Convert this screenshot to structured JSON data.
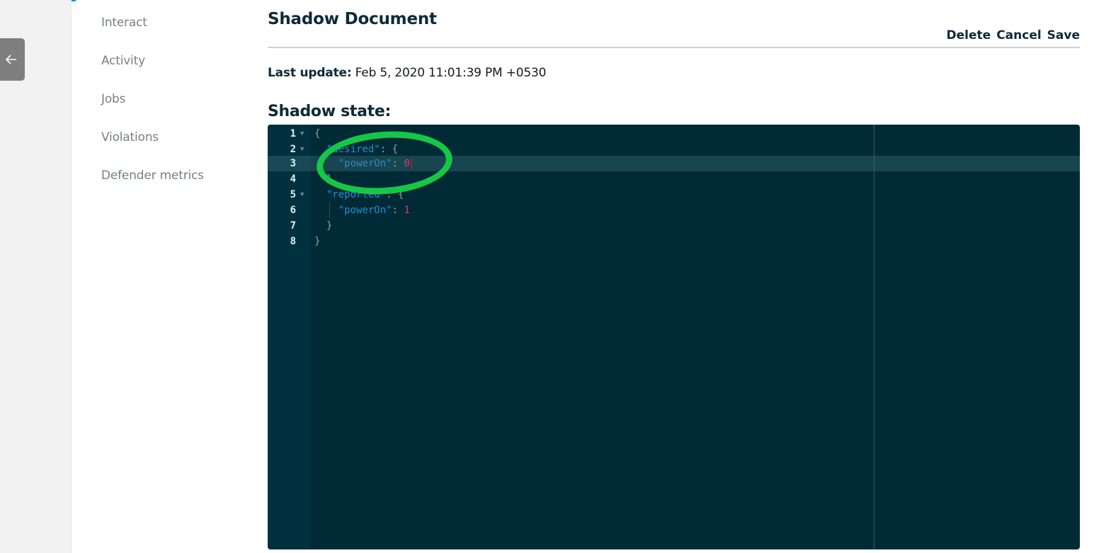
{
  "left_rail": {
    "back_button": {
      "icon": "arrow-left-icon"
    }
  },
  "subnav": {
    "items": [
      {
        "label": "Interact"
      },
      {
        "label": "Activity"
      },
      {
        "label": "Jobs"
      },
      {
        "label": "Violations"
      },
      {
        "label": "Defender metrics"
      }
    ]
  },
  "header": {
    "title": "Shadow Document",
    "actions": {
      "delete": "Delete",
      "cancel": "Cancel",
      "save": "Save"
    }
  },
  "last_update": {
    "label": "Last update:",
    "value": "Feb 5, 2020 11:01:39 PM +0530"
  },
  "shadow_state": {
    "label": "Shadow state:",
    "active_line": 3,
    "lines": [
      {
        "num": "1",
        "text": "{"
      },
      {
        "num": "2",
        "indent": "  ",
        "key": "\"desired\"",
        "rest": ": {"
      },
      {
        "num": "3",
        "indent": "    ",
        "key": "\"powerOn\"",
        "sep": ": ",
        "value": "0"
      },
      {
        "num": "4",
        "text": "  },"
      },
      {
        "num": "5",
        "indent": "  ",
        "key": "\"reported\"",
        "rest": ": {"
      },
      {
        "num": "6",
        "indent": "    ",
        "key": "\"powerOn\"",
        "sep": ": ",
        "value": "1"
      },
      {
        "num": "7",
        "text": "  }"
      },
      {
        "num": "8",
        "text": "}"
      }
    ]
  },
  "colors": {
    "editor_bg": "#002b36",
    "key": "#268bd2",
    "number": "#d33682",
    "annotation": "#16c746"
  }
}
